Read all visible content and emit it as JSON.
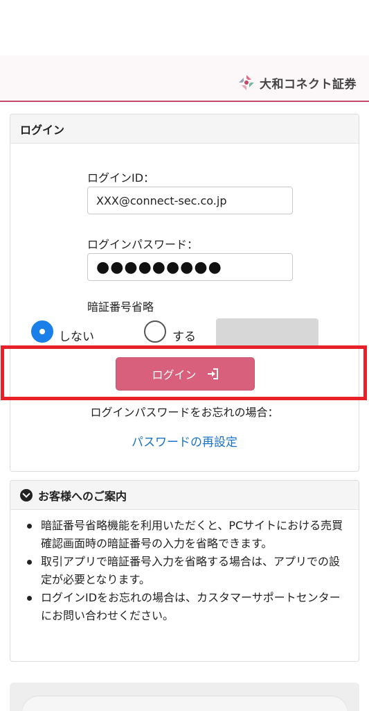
{
  "header": {
    "brand_name": "大和コネクト証券",
    "logo_icon": "daiwa-connect-logo-icon"
  },
  "login": {
    "panel_title": "ログイン",
    "id_label": "ログインID：",
    "id_value": "XXX@connect-sec.co.jp",
    "password_label": "ログインパスワード：",
    "password_mask": "●●●●●●●●●",
    "pin_skip_label": "暗証番号省略",
    "radio_no": "しない",
    "radio_yes": "する",
    "pin_skip_selected": "しない",
    "login_button": "ログイン",
    "forgot_text": "ログインパスワードをお忘れの場合：",
    "reset_link": "パスワードの再設定"
  },
  "info": {
    "title": "お客様へのご案内",
    "items": [
      "暗証番号省略機能を利用いただくと、PCサイトにおける売買確認画面時の暗証番号の入力を省略できます。",
      "取引アプリで暗証番号入力を省略する場合は、アプリでの設定が必要となります。",
      "ログインIDをお忘れの場合は、カスタマーサポートセンターにお問い合わせください。"
    ]
  },
  "colors": {
    "brand": "#c04a6a",
    "login_button": "#d9607c",
    "link": "#1a73c8",
    "radio_selected": "#1a7fe8",
    "highlight": "#e8202a"
  }
}
